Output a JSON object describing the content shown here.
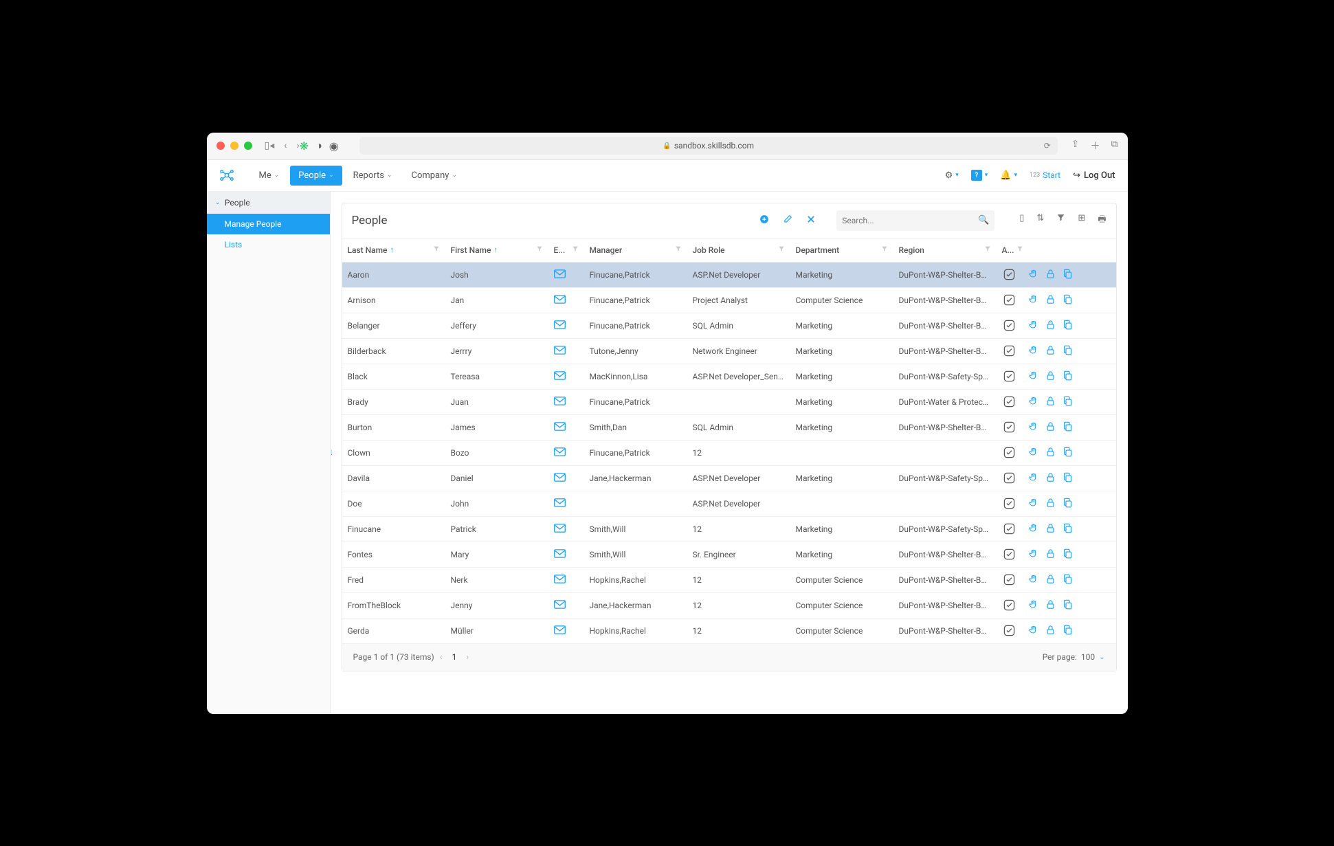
{
  "browser": {
    "url": "sandbox.skillsdb.com"
  },
  "nav": {
    "items": [
      {
        "label": "Me",
        "active": false
      },
      {
        "label": "People",
        "active": true
      },
      {
        "label": "Reports",
        "active": false
      },
      {
        "label": "Company",
        "active": false
      }
    ],
    "start": "Start",
    "logout": "Log Out"
  },
  "sidebar": {
    "header": "People",
    "items": [
      {
        "label": "Manage People",
        "active": true
      },
      {
        "label": "Lists",
        "active": false
      }
    ]
  },
  "panel": {
    "title": "People",
    "search_placeholder": "Search..."
  },
  "columns": [
    {
      "key": "last",
      "label": "Last Name",
      "sort": true
    },
    {
      "key": "first",
      "label": "First Name",
      "sort": true
    },
    {
      "key": "em",
      "label": "E...",
      "sort": false
    },
    {
      "key": "mgr",
      "label": "Manager",
      "sort": false
    },
    {
      "key": "job",
      "label": "Job Role",
      "sort": false
    },
    {
      "key": "dept",
      "label": "Department",
      "sort": false
    },
    {
      "key": "reg",
      "label": "Region",
      "sort": false
    },
    {
      "key": "act",
      "label": "A...",
      "sort": false
    }
  ],
  "rows": [
    {
      "last": "Aaron",
      "first": "Josh",
      "mgr": "Finucane,Patrick",
      "job": "ASP.Net Developer",
      "dept": "Marketing",
      "reg": "DuPont-W&P-Shelter-Burley",
      "sel": true
    },
    {
      "last": "Arnison",
      "first": "Jan",
      "mgr": "Finucane,Patrick",
      "job": "Project Analyst",
      "dept": "Computer Science",
      "reg": "DuPont-W&P-Shelter-Burley"
    },
    {
      "last": "Belanger",
      "first": "Jeffery",
      "mgr": "Finucane,Patrick",
      "job": "SQL Admin",
      "dept": "Marketing",
      "reg": "DuPont-W&P-Shelter-Burley"
    },
    {
      "last": "Bilderback",
      "first": "Jerrry",
      "mgr": "Tutone,Jenny",
      "job": "Network Engineer",
      "dept": "Marketing",
      "reg": "DuPont-W&P-Shelter-Burley"
    },
    {
      "last": "Black",
      "first": "Tereasa",
      "mgr": "MacKinnon,Lisa",
      "job": "ASP.Net Developer_Senior",
      "dept": "Marketing",
      "reg": "DuPont-W&P-Safety-Sprua..."
    },
    {
      "last": "Brady",
      "first": "Juan",
      "mgr": "Finucane,Patrick",
      "job": "",
      "dept": "Marketing",
      "reg": "DuPont-Water & Protectio..."
    },
    {
      "last": "Burton",
      "first": "James",
      "mgr": "Smith,Dan",
      "job": "SQL Admin",
      "dept": "Marketing",
      "reg": "DuPont-W&P-Shelter-Burley"
    },
    {
      "last": "Clown",
      "first": "Bozo",
      "mgr": "Finucane,Patrick",
      "job": "12",
      "dept": "",
      "reg": ""
    },
    {
      "last": "Davila",
      "first": "Daniel",
      "mgr": "Jane,Hackerman",
      "job": "ASP.Net Developer",
      "dept": "Marketing",
      "reg": "DuPont-W&P-Safety-Sprua..."
    },
    {
      "last": "Doe",
      "first": "John",
      "mgr": "",
      "job": "ASP.Net Developer",
      "dept": "",
      "reg": ""
    },
    {
      "last": "Finucane",
      "first": "Patrick",
      "mgr": "Smith,Will",
      "job": "12",
      "dept": "Marketing",
      "reg": "DuPont-W&P-Safety-Sprua..."
    },
    {
      "last": "Fontes",
      "first": "Mary",
      "mgr": "Smith,Will",
      "job": "Sr. Engineer",
      "dept": "Marketing",
      "reg": "DuPont-W&P-Shelter-Burley"
    },
    {
      "last": "Fred",
      "first": "Nerk",
      "mgr": "Hopkins,Rachel",
      "job": "12",
      "dept": "Computer Science",
      "reg": "DuPont-W&P-Shelter-Burley"
    },
    {
      "last": "FromTheBlock",
      "first": "Jenny",
      "mgr": "Jane,Hackerman",
      "job": "12",
      "dept": "Computer Science",
      "reg": "DuPont-W&P-Shelter-Burley"
    },
    {
      "last": "Gerda",
      "first": "Müller",
      "mgr": "Hopkins,Rachel",
      "job": "12",
      "dept": "Computer Science",
      "reg": "DuPont-W&P-Shelter-Burley"
    }
  ],
  "pager": {
    "text": "Page 1 of 1 (73 items)",
    "current": "1",
    "per_page_label": "Per page:",
    "per_page_value": "100"
  }
}
